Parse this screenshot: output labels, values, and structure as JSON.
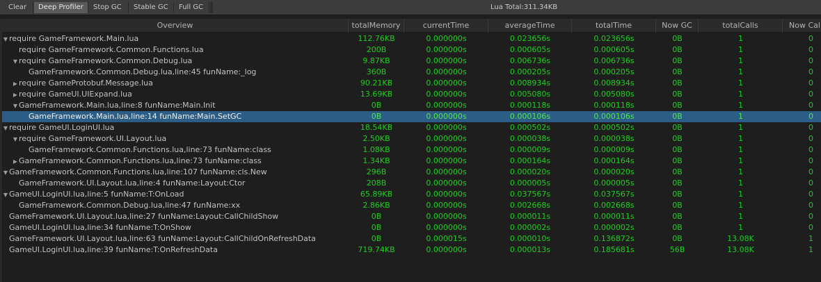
{
  "toolbar": {
    "buttons": [
      "Clear",
      "Deep Profiler",
      "Stop GC",
      "Stable GC",
      "Full GC"
    ],
    "active": "Deep Profiler",
    "lua_total": "Lua Total:311.34KB"
  },
  "columns": [
    "Overview",
    "totalMemory",
    "currentTime",
    "averageTime",
    "totalTime",
    "Now GC",
    "totalCalls",
    "Now Cal"
  ],
  "colors": {
    "value_text": "#19d119",
    "selection": "#2c5d87",
    "background": "#1e1e1e"
  },
  "rows": [
    {
      "depth": 0,
      "toggle": "expanded",
      "name": "require GameFramework.Main.lua",
      "totalMemory": "112.76KB",
      "currentTime": "0.000000s",
      "averageTime": "0.023656s",
      "totalTime": "0.023656s",
      "nowGC": "0B",
      "totalCalls": "1",
      "nowCalls": "0"
    },
    {
      "depth": 1,
      "toggle": "none",
      "name": "require GameFramework.Common.Functions.lua",
      "totalMemory": "200B",
      "currentTime": "0.000000s",
      "averageTime": "0.000605s",
      "totalTime": "0.000605s",
      "nowGC": "0B",
      "totalCalls": "1",
      "nowCalls": "0"
    },
    {
      "depth": 1,
      "toggle": "expanded",
      "name": "require GameFramework.Common.Debug.lua",
      "totalMemory": "9.87KB",
      "currentTime": "0.000000s",
      "averageTime": "0.006736s",
      "totalTime": "0.006736s",
      "nowGC": "0B",
      "totalCalls": "1",
      "nowCalls": "0"
    },
    {
      "depth": 2,
      "toggle": "none",
      "name": "GameFramework.Common.Debug.lua,line:45 funName:_log",
      "totalMemory": "360B",
      "currentTime": "0.000000s",
      "averageTime": "0.000205s",
      "totalTime": "0.000205s",
      "nowGC": "0B",
      "totalCalls": "1",
      "nowCalls": "0"
    },
    {
      "depth": 1,
      "toggle": "collapsed",
      "name": "require GameProtobuf.Message.lua",
      "totalMemory": "90.21KB",
      "currentTime": "0.000000s",
      "averageTime": "0.008934s",
      "totalTime": "0.008934s",
      "nowGC": "0B",
      "totalCalls": "1",
      "nowCalls": "0"
    },
    {
      "depth": 1,
      "toggle": "collapsed",
      "name": "require GameUI.UIExpand.lua",
      "totalMemory": "13.69KB",
      "currentTime": "0.000000s",
      "averageTime": "0.005080s",
      "totalTime": "0.005080s",
      "nowGC": "0B",
      "totalCalls": "1",
      "nowCalls": "0"
    },
    {
      "depth": 1,
      "toggle": "expanded",
      "name": "GameFramework.Main.lua,line:8 funName:Main.Init",
      "totalMemory": "0B",
      "currentTime": "0.000000s",
      "averageTime": "0.000118s",
      "totalTime": "0.000118s",
      "nowGC": "0B",
      "totalCalls": "1",
      "nowCalls": "0"
    },
    {
      "depth": 2,
      "toggle": "none",
      "selected": true,
      "name": "GameFramework.Main.lua,line:14 funName:Main.SetGC",
      "totalMemory": "0B",
      "currentTime": "0.000000s",
      "averageTime": "0.000106s",
      "totalTime": "0.000106s",
      "nowGC": "0B",
      "totalCalls": "1",
      "nowCalls": "0"
    },
    {
      "depth": 0,
      "toggle": "expanded",
      "name": "require GameUI.LoginUI.lua",
      "totalMemory": "18.54KB",
      "currentTime": "0.000000s",
      "averageTime": "0.000502s",
      "totalTime": "0.000502s",
      "nowGC": "0B",
      "totalCalls": "1",
      "nowCalls": "0"
    },
    {
      "depth": 1,
      "toggle": "expanded",
      "name": "require GameFramework.UI.Layout.lua",
      "totalMemory": "2.50KB",
      "currentTime": "0.000000s",
      "averageTime": "0.000038s",
      "totalTime": "0.000038s",
      "nowGC": "0B",
      "totalCalls": "1",
      "nowCalls": "0"
    },
    {
      "depth": 2,
      "toggle": "none",
      "name": "GameFramework.Common.Functions.lua,line:73 funName:class",
      "totalMemory": "1.08KB",
      "currentTime": "0.000000s",
      "averageTime": "0.000009s",
      "totalTime": "0.000009s",
      "nowGC": "0B",
      "totalCalls": "1",
      "nowCalls": "0"
    },
    {
      "depth": 1,
      "toggle": "collapsed",
      "name": "GameFramework.Common.Functions.lua,line:73 funName:class",
      "totalMemory": "1.34KB",
      "currentTime": "0.000000s",
      "averageTime": "0.000164s",
      "totalTime": "0.000164s",
      "nowGC": "0B",
      "totalCalls": "1",
      "nowCalls": "0"
    },
    {
      "depth": 0,
      "toggle": "expanded",
      "name": "GameFramework.Common.Functions.lua,line:107 funName:cls.New",
      "totalMemory": "296B",
      "currentTime": "0.000000s",
      "averageTime": "0.000020s",
      "totalTime": "0.000020s",
      "nowGC": "0B",
      "totalCalls": "1",
      "nowCalls": "0"
    },
    {
      "depth": 1,
      "toggle": "none",
      "name": "GameFramework.UI.Layout.lua,line:4 funName:Layout:Ctor",
      "totalMemory": "208B",
      "currentTime": "0.000000s",
      "averageTime": "0.000005s",
      "totalTime": "0.000005s",
      "nowGC": "0B",
      "totalCalls": "1",
      "nowCalls": "0"
    },
    {
      "depth": 0,
      "toggle": "expanded",
      "name": "GameUI.LoginUI.lua,line:5 funName:T:OnLoad",
      "totalMemory": "65.89KB",
      "currentTime": "0.000000s",
      "averageTime": "0.037567s",
      "totalTime": "0.037567s",
      "nowGC": "0B",
      "totalCalls": "1",
      "nowCalls": "0"
    },
    {
      "depth": 1,
      "toggle": "none",
      "name": "GameFramework.Common.Debug.lua,line:47 funName:xx",
      "totalMemory": "2.86KB",
      "currentTime": "0.000000s",
      "averageTime": "0.002668s",
      "totalTime": "0.002668s",
      "nowGC": "0B",
      "totalCalls": "1",
      "nowCalls": "0"
    },
    {
      "depth": 0,
      "toggle": "none",
      "name": "GameFramework.UI.Layout.lua,line:27 funName:Layout:CallChildShow",
      "totalMemory": "0B",
      "currentTime": "0.000000s",
      "averageTime": "0.000011s",
      "totalTime": "0.000011s",
      "nowGC": "0B",
      "totalCalls": "1",
      "nowCalls": "0"
    },
    {
      "depth": 0,
      "toggle": "none",
      "name": "GameUI.LoginUI.lua,line:34 funName:T:OnShow",
      "totalMemory": "0B",
      "currentTime": "0.000000s",
      "averageTime": "0.000002s",
      "totalTime": "0.000002s",
      "nowGC": "0B",
      "totalCalls": "1",
      "nowCalls": "0"
    },
    {
      "depth": 0,
      "toggle": "none",
      "name": "GameFramework.UI.Layout.lua,line:63 funName:Layout:CallChildOnRefreshData",
      "totalMemory": "0B",
      "currentTime": "0.000015s",
      "averageTime": "0.000010s",
      "totalTime": "0.136872s",
      "nowGC": "0B",
      "totalCalls": "13.08K",
      "nowCalls": "1"
    },
    {
      "depth": 0,
      "toggle": "none",
      "name": "GameUI.LoginUI.lua,line:39 funName:T:OnRefreshData",
      "totalMemory": "719.74KB",
      "currentTime": "0.000000s",
      "averageTime": "0.000013s",
      "totalTime": "0.185681s",
      "nowGC": "56B",
      "totalCalls": "13.08K",
      "nowCalls": "1"
    }
  ]
}
